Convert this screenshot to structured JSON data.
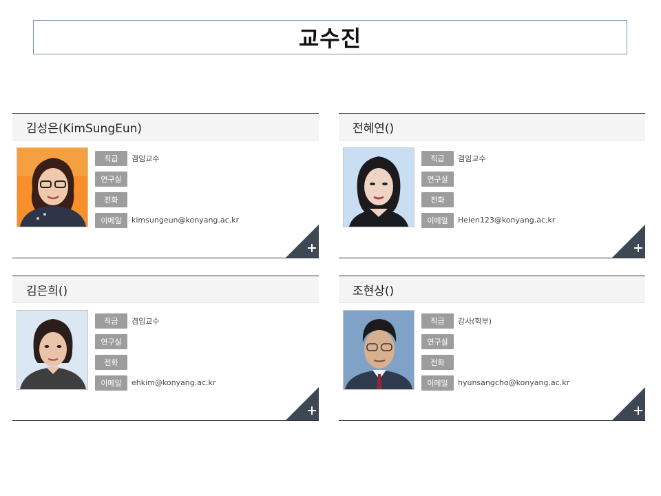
{
  "page": {
    "title": "교수진"
  },
  "labels": {
    "position": "직급",
    "office": "연구실",
    "phone": "전화",
    "email": "이메일"
  },
  "professors": [
    {
      "name": "김성은(KimSungEun)",
      "position": "겸임교수",
      "office": "",
      "phone": "",
      "email": "kimsungeun@konyang.ac.kr"
    },
    {
      "name": "전혜연()",
      "position": "겸임교수",
      "office": "",
      "phone": "",
      "email": "Helen123@konyang.ac.kr"
    },
    {
      "name": "김은희()",
      "position": "겸임교수",
      "office": "",
      "phone": "",
      "email": "ehkim@konyang.ac.kr"
    },
    {
      "name": "조현상()",
      "position": "강사(학부)",
      "office": "",
      "phone": "",
      "email": "hyunsangcho@konyang.ac.kr"
    }
  ],
  "colors": {
    "accent_corner": "#3e4855",
    "label_bg": "#9d9d9d",
    "title_border": "#6f8fae"
  },
  "icons": {
    "more": "plus-icon"
  }
}
